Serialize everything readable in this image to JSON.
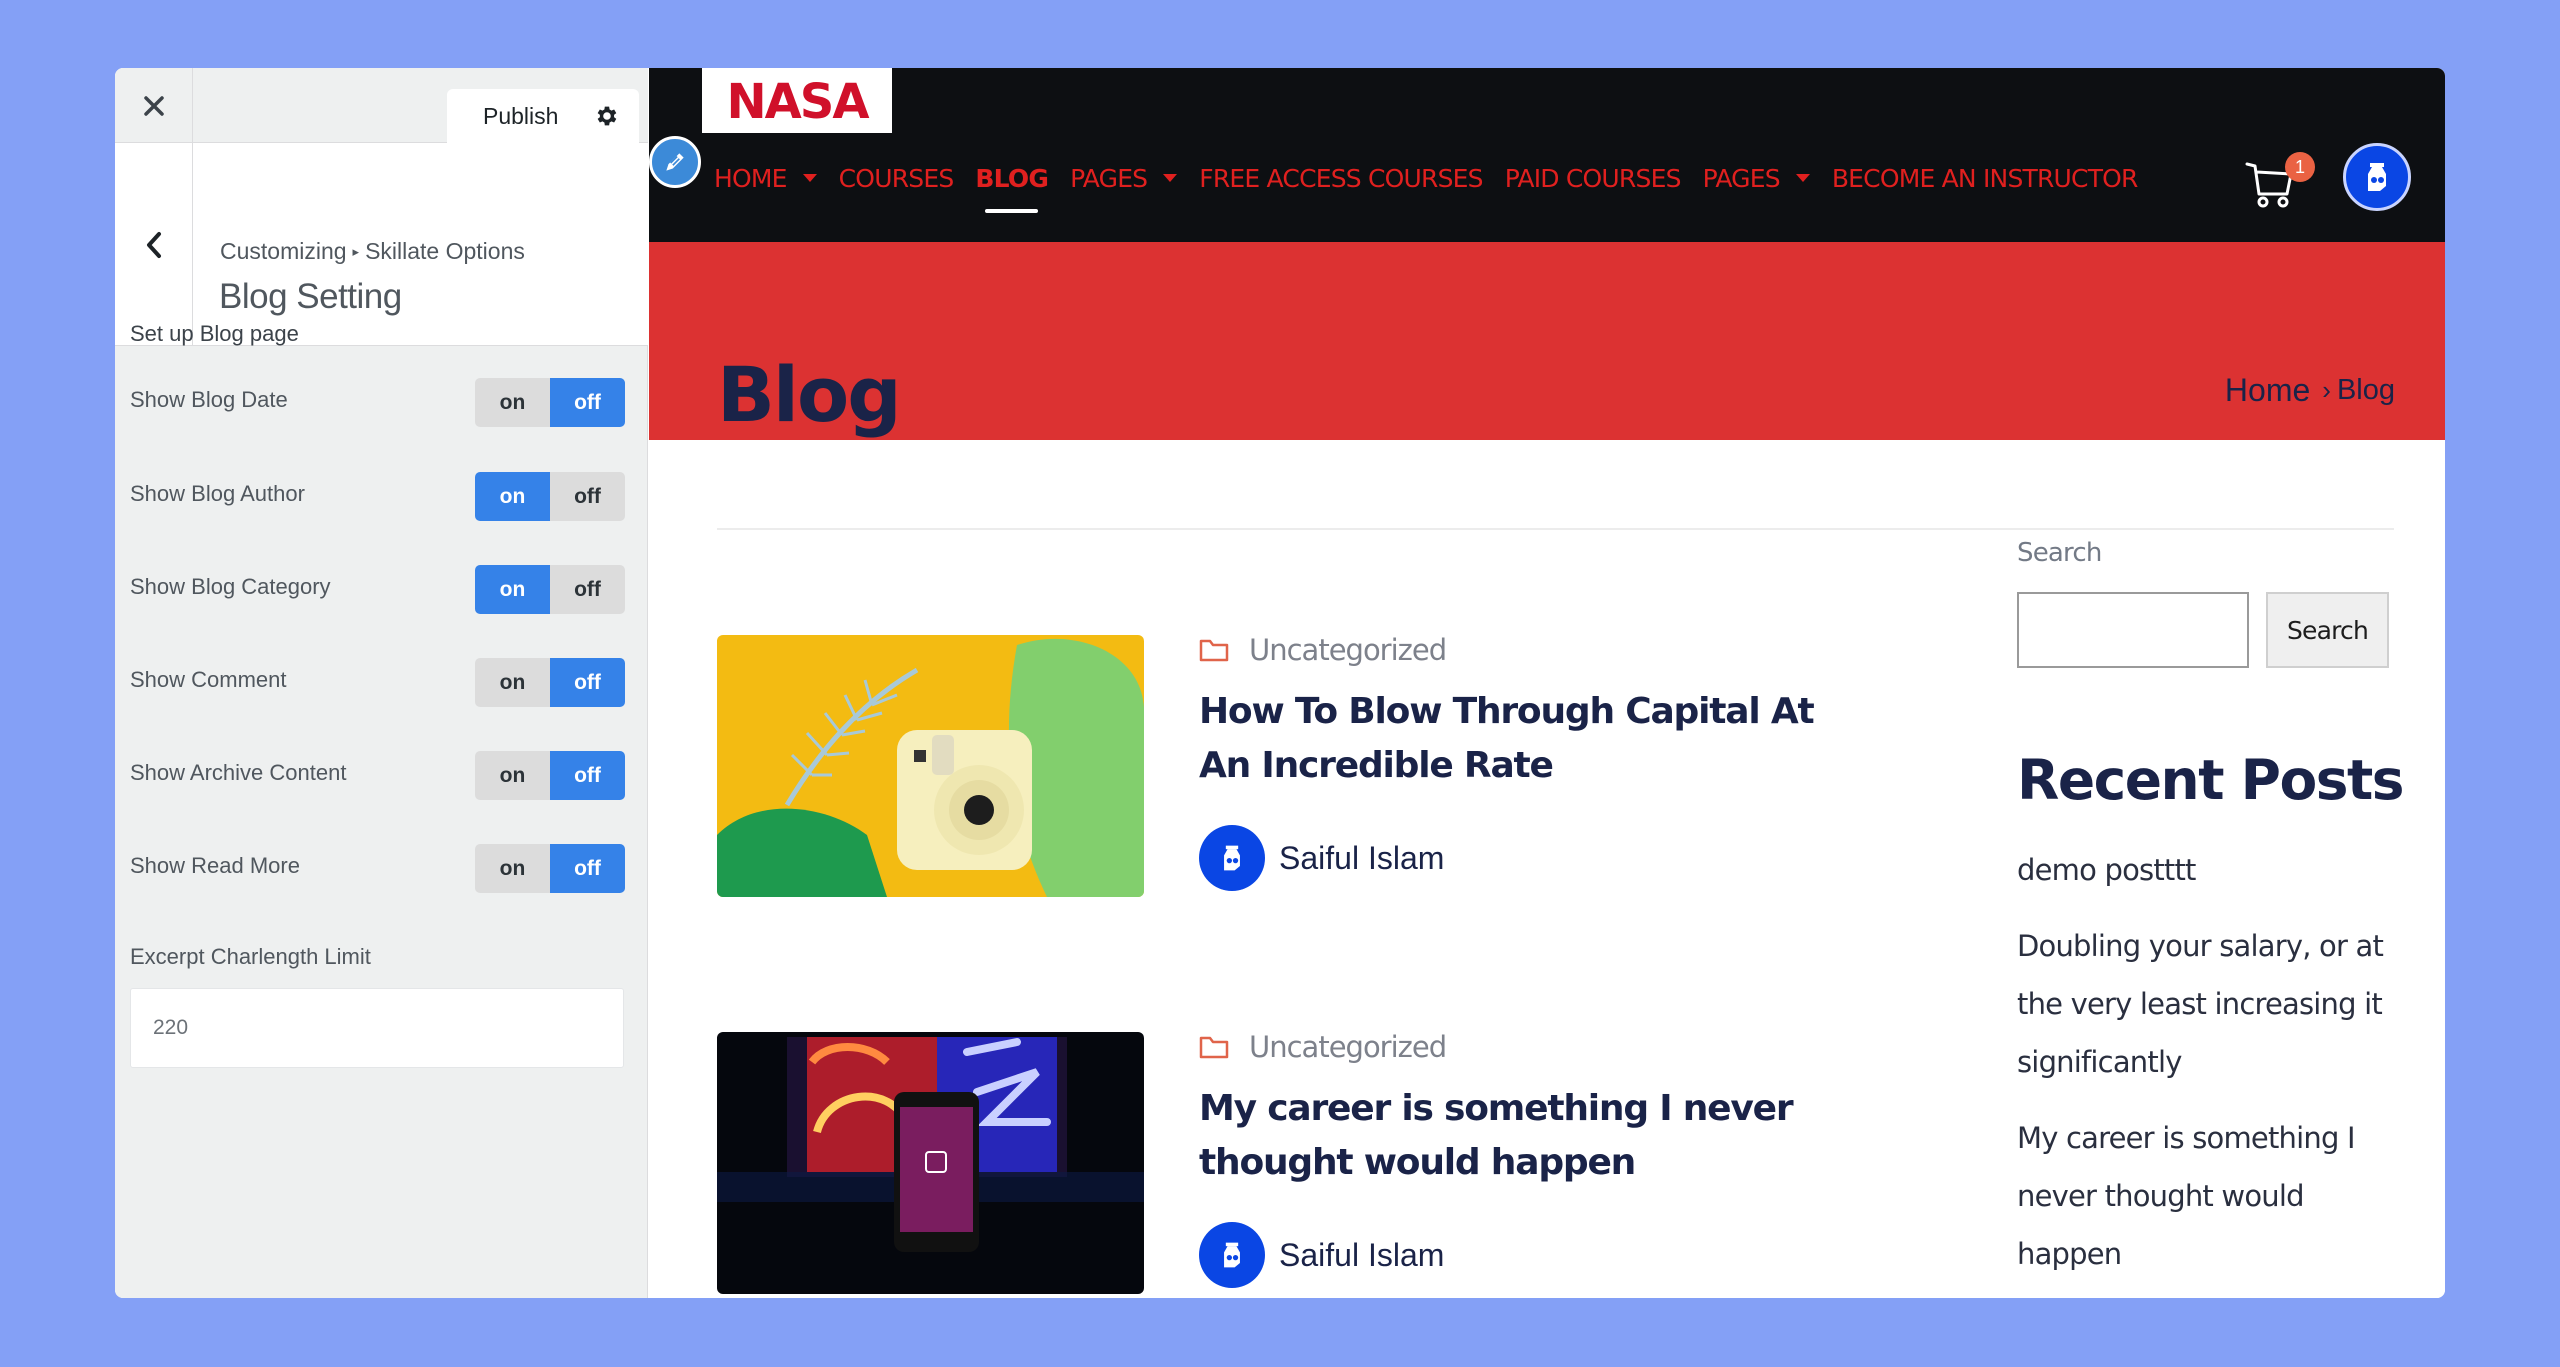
{
  "customizer": {
    "publish_label": "Publish",
    "breadcrumb_root": "Customizing",
    "breadcrumb_separator": "▸",
    "breadcrumb_parent": "Skillate Options",
    "section_title": "Blog Setting",
    "group_title": "Set up Blog page",
    "toggles": [
      {
        "label": "Show Blog Date",
        "on_label": "on",
        "off_label": "off",
        "value": "off"
      },
      {
        "label": "Show Blog Author",
        "on_label": "on",
        "off_label": "off",
        "value": "on"
      },
      {
        "label": "Show Blog Category",
        "on_label": "on",
        "off_label": "off",
        "value": "on"
      },
      {
        "label": "Show Comment",
        "on_label": "on",
        "off_label": "off",
        "value": "off"
      },
      {
        "label": "Show Archive Content",
        "on_label": "on",
        "off_label": "off",
        "value": "off"
      },
      {
        "label": "Show Read More",
        "on_label": "on",
        "off_label": "off",
        "value": "off"
      }
    ],
    "excerpt_label": "Excerpt Charlength Limit",
    "excerpt_value": "220",
    "accent_color": "#3582e8"
  },
  "site": {
    "logo_text": "NASA",
    "logo_color": "#d0102a",
    "nav": [
      {
        "label": "HOME",
        "dropdown": true,
        "active": false
      },
      {
        "label": "COURSES",
        "dropdown": false,
        "active": false
      },
      {
        "label": "BLOG",
        "dropdown": false,
        "active": true
      },
      {
        "label": "PAGES",
        "dropdown": true,
        "active": false
      },
      {
        "label": "FREE ACCESS COURSES",
        "dropdown": false,
        "active": false
      },
      {
        "label": "PAID COURSES",
        "dropdown": false,
        "active": false
      },
      {
        "label": "PAGES",
        "dropdown": true,
        "active": false
      },
      {
        "label": "BECOME AN INSTRUCTOR",
        "dropdown": false,
        "active": false
      }
    ],
    "cart_count": "1",
    "header_bg": "#0d0f12",
    "nav_color": "#e0201f",
    "banner_color": "#dc3232"
  },
  "banner": {
    "title": "Blog",
    "breadcrumb_home": "Home",
    "breadcrumb_separator": "›",
    "breadcrumb_current": "Blog"
  },
  "posts": [
    {
      "category": "Uncategorized",
      "title": "How To Blow Through Capital At An Incredible Rate",
      "author": "Saiful Islam",
      "thumbnail": "instant-camera-on-yellow"
    },
    {
      "category": "Uncategorized",
      "title": "My career is something I never thought would happen",
      "author": "Saiful Islam",
      "thumbnail": "phone-adobe-xd-neon"
    }
  ],
  "sidebar_widgets": {
    "search_label": "Search",
    "search_placeholder": "",
    "search_button": "Search",
    "recent_title": "Recent Posts",
    "recent_posts": [
      "demo postttt",
      "Doubling your salary, or at the very least increasing it significantly",
      "My career is something I never thought would happen"
    ]
  }
}
